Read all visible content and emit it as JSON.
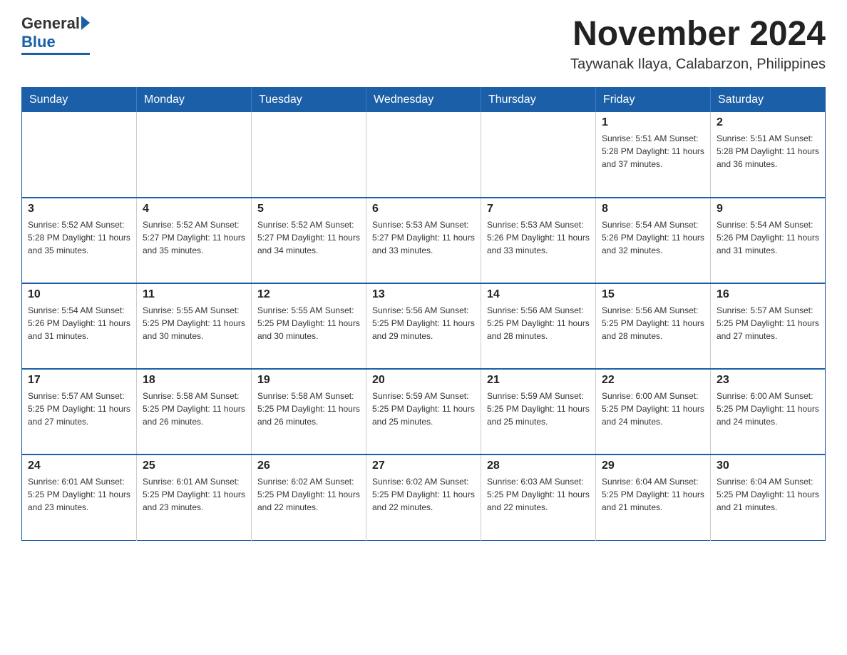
{
  "header": {
    "logo": {
      "general": "General",
      "blue": "Blue"
    },
    "title": "November 2024",
    "subtitle": "Taywanak Ilaya, Calabarzon, Philippines"
  },
  "calendar": {
    "days_of_week": [
      "Sunday",
      "Monday",
      "Tuesday",
      "Wednesday",
      "Thursday",
      "Friday",
      "Saturday"
    ],
    "weeks": [
      [
        {
          "day": "",
          "info": ""
        },
        {
          "day": "",
          "info": ""
        },
        {
          "day": "",
          "info": ""
        },
        {
          "day": "",
          "info": ""
        },
        {
          "day": "",
          "info": ""
        },
        {
          "day": "1",
          "info": "Sunrise: 5:51 AM\nSunset: 5:28 PM\nDaylight: 11 hours\nand 37 minutes."
        },
        {
          "day": "2",
          "info": "Sunrise: 5:51 AM\nSunset: 5:28 PM\nDaylight: 11 hours\nand 36 minutes."
        }
      ],
      [
        {
          "day": "3",
          "info": "Sunrise: 5:52 AM\nSunset: 5:28 PM\nDaylight: 11 hours\nand 35 minutes."
        },
        {
          "day": "4",
          "info": "Sunrise: 5:52 AM\nSunset: 5:27 PM\nDaylight: 11 hours\nand 35 minutes."
        },
        {
          "day": "5",
          "info": "Sunrise: 5:52 AM\nSunset: 5:27 PM\nDaylight: 11 hours\nand 34 minutes."
        },
        {
          "day": "6",
          "info": "Sunrise: 5:53 AM\nSunset: 5:27 PM\nDaylight: 11 hours\nand 33 minutes."
        },
        {
          "day": "7",
          "info": "Sunrise: 5:53 AM\nSunset: 5:26 PM\nDaylight: 11 hours\nand 33 minutes."
        },
        {
          "day": "8",
          "info": "Sunrise: 5:54 AM\nSunset: 5:26 PM\nDaylight: 11 hours\nand 32 minutes."
        },
        {
          "day": "9",
          "info": "Sunrise: 5:54 AM\nSunset: 5:26 PM\nDaylight: 11 hours\nand 31 minutes."
        }
      ],
      [
        {
          "day": "10",
          "info": "Sunrise: 5:54 AM\nSunset: 5:26 PM\nDaylight: 11 hours\nand 31 minutes."
        },
        {
          "day": "11",
          "info": "Sunrise: 5:55 AM\nSunset: 5:25 PM\nDaylight: 11 hours\nand 30 minutes."
        },
        {
          "day": "12",
          "info": "Sunrise: 5:55 AM\nSunset: 5:25 PM\nDaylight: 11 hours\nand 30 minutes."
        },
        {
          "day": "13",
          "info": "Sunrise: 5:56 AM\nSunset: 5:25 PM\nDaylight: 11 hours\nand 29 minutes."
        },
        {
          "day": "14",
          "info": "Sunrise: 5:56 AM\nSunset: 5:25 PM\nDaylight: 11 hours\nand 28 minutes."
        },
        {
          "day": "15",
          "info": "Sunrise: 5:56 AM\nSunset: 5:25 PM\nDaylight: 11 hours\nand 28 minutes."
        },
        {
          "day": "16",
          "info": "Sunrise: 5:57 AM\nSunset: 5:25 PM\nDaylight: 11 hours\nand 27 minutes."
        }
      ],
      [
        {
          "day": "17",
          "info": "Sunrise: 5:57 AM\nSunset: 5:25 PM\nDaylight: 11 hours\nand 27 minutes."
        },
        {
          "day": "18",
          "info": "Sunrise: 5:58 AM\nSunset: 5:25 PM\nDaylight: 11 hours\nand 26 minutes."
        },
        {
          "day": "19",
          "info": "Sunrise: 5:58 AM\nSunset: 5:25 PM\nDaylight: 11 hours\nand 26 minutes."
        },
        {
          "day": "20",
          "info": "Sunrise: 5:59 AM\nSunset: 5:25 PM\nDaylight: 11 hours\nand 25 minutes."
        },
        {
          "day": "21",
          "info": "Sunrise: 5:59 AM\nSunset: 5:25 PM\nDaylight: 11 hours\nand 25 minutes."
        },
        {
          "day": "22",
          "info": "Sunrise: 6:00 AM\nSunset: 5:25 PM\nDaylight: 11 hours\nand 24 minutes."
        },
        {
          "day": "23",
          "info": "Sunrise: 6:00 AM\nSunset: 5:25 PM\nDaylight: 11 hours\nand 24 minutes."
        }
      ],
      [
        {
          "day": "24",
          "info": "Sunrise: 6:01 AM\nSunset: 5:25 PM\nDaylight: 11 hours\nand 23 minutes."
        },
        {
          "day": "25",
          "info": "Sunrise: 6:01 AM\nSunset: 5:25 PM\nDaylight: 11 hours\nand 23 minutes."
        },
        {
          "day": "26",
          "info": "Sunrise: 6:02 AM\nSunset: 5:25 PM\nDaylight: 11 hours\nand 22 minutes."
        },
        {
          "day": "27",
          "info": "Sunrise: 6:02 AM\nSunset: 5:25 PM\nDaylight: 11 hours\nand 22 minutes."
        },
        {
          "day": "28",
          "info": "Sunrise: 6:03 AM\nSunset: 5:25 PM\nDaylight: 11 hours\nand 22 minutes."
        },
        {
          "day": "29",
          "info": "Sunrise: 6:04 AM\nSunset: 5:25 PM\nDaylight: 11 hours\nand 21 minutes."
        },
        {
          "day": "30",
          "info": "Sunrise: 6:04 AM\nSunset: 5:25 PM\nDaylight: 11 hours\nand 21 minutes."
        }
      ]
    ]
  }
}
